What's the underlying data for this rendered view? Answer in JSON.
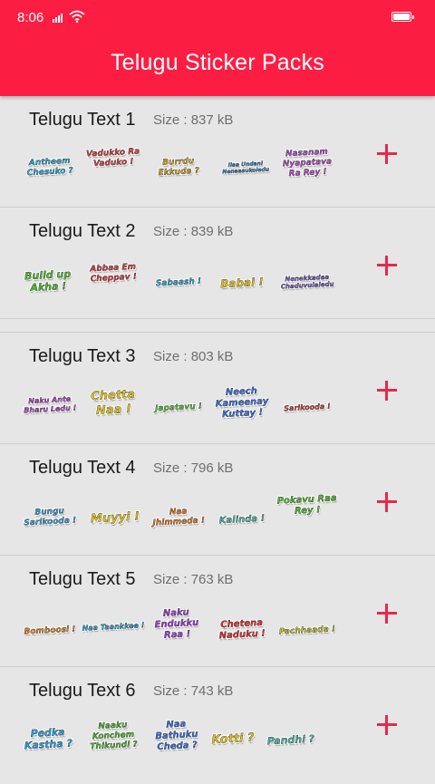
{
  "status": {
    "time": "8:06"
  },
  "header": {
    "title": "Telugu Sticker Packs",
    "color": "#fc1d43"
  },
  "size_label": "Size : ",
  "accent_color": "#e8284a",
  "packs": [
    {
      "name": "Telugu Text 1",
      "size": "837 kB",
      "stickers": [
        "Antheem Chesuko ?",
        "Vadukko Ra Vaduko !",
        "Burrdu Ekkuda ?",
        "Ilaa Undani Nenaasukoledu",
        "Nasanam Nyapatava Ra Rey !"
      ]
    },
    {
      "name": "Telugu Text 2",
      "size": "839 kB",
      "stickers": [
        "Build up Akha !",
        "Abbaa Em Cheppav !",
        "Sabaash !",
        "Babai !",
        "Nenekkadaa Chaduvulaledu"
      ]
    },
    {
      "name": "Telugu Text 3",
      "size": "803 kB",
      "stickers": [
        "Naku Ante Bharu Ledu !",
        "Chetta Naa !",
        "Japatavu !",
        "Neech Kameenay Kuttay !",
        "Sarikooda !"
      ]
    },
    {
      "name": "Telugu Text 4",
      "size": "796 kB",
      "stickers": [
        "Bungu Sarikooda !",
        "Muyyi !",
        "Naa Jhimmeda !",
        "Kalinda !",
        "Pokavu Raa Rey !"
      ]
    },
    {
      "name": "Telugu Text 5",
      "size": "763 kB",
      "stickers": [
        "Bomboosi !",
        "Naa Taankkee !",
        "Naku Endukku Raa !",
        "Chetena Naduku !",
        "Pachhaada !"
      ]
    },
    {
      "name": "Telugu Text 6",
      "size": "743 kB",
      "stickers": [
        "Pedka Kastha ?",
        "Naaku Konchem Thikundi ?",
        "Naa Bathuku Cheda ?",
        "Kotti ?",
        "Pandhi ?"
      ]
    }
  ]
}
